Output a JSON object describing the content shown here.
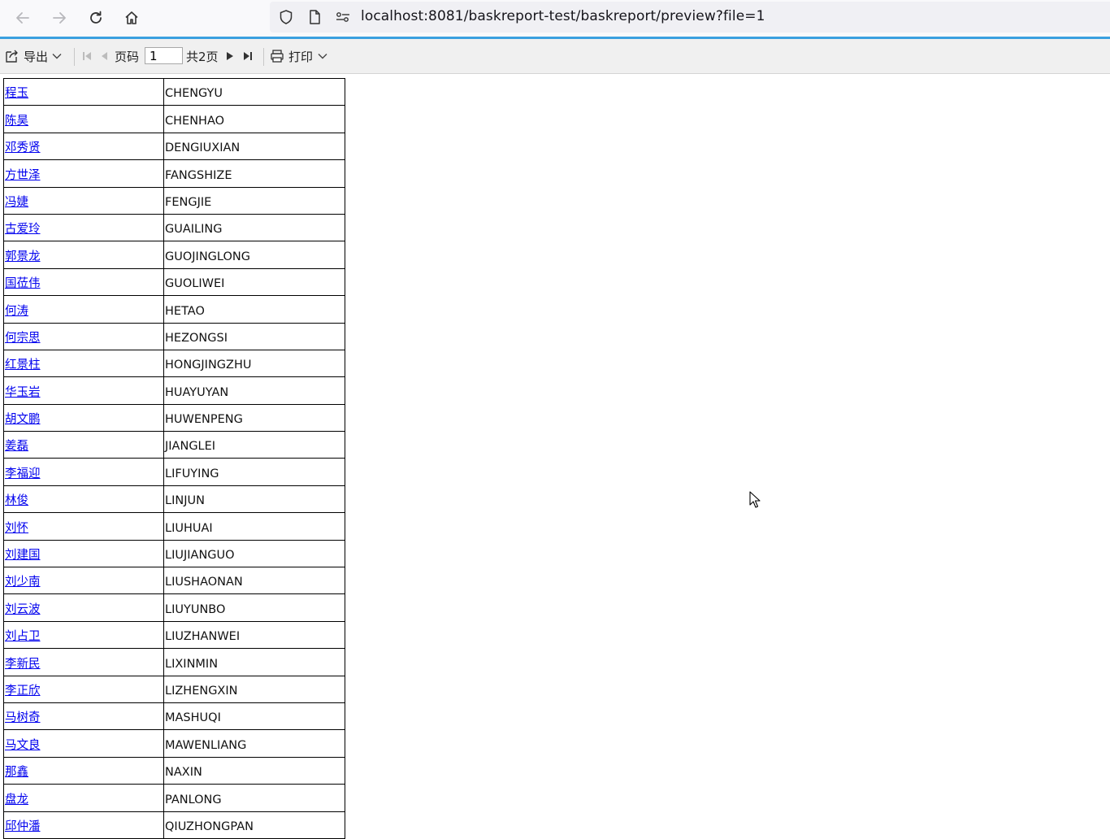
{
  "browser": {
    "url": "localhost:8081/baskreport-test/baskreport/preview?file=1",
    "icons": [
      "back-arrow-icon",
      "forward-arrow-icon",
      "reload-icon",
      "home-icon",
      "shield-icon",
      "page-icon",
      "permissions-icon"
    ]
  },
  "toolbar": {
    "export_label": "导出",
    "page_label": "页码",
    "page_value": "1",
    "total_pages": "共2页",
    "print_label": "打印"
  },
  "rows": [
    {
      "name": "程玉",
      "pinyin": "CHENGYU"
    },
    {
      "name": "陈昊",
      "pinyin": "CHENHAO"
    },
    {
      "name": "邓秀贤",
      "pinyin": "DENGIUXIAN"
    },
    {
      "name": "方世泽",
      "pinyin": "FANGSHIZE"
    },
    {
      "name": "冯婕",
      "pinyin": "FENGJIE"
    },
    {
      "name": "古爱玲",
      "pinyin": "GUAILING"
    },
    {
      "name": "郭景龙",
      "pinyin": "GUOJINGLONG"
    },
    {
      "name": "国莅伟",
      "pinyin": "GUOLIWEI"
    },
    {
      "name": "何涛",
      "pinyin": "HETAO"
    },
    {
      "name": "何宗思",
      "pinyin": "HEZONGSI"
    },
    {
      "name": "红景柱",
      "pinyin": "HONGJINGZHU"
    },
    {
      "name": "华玉岩",
      "pinyin": "HUAYUYAN"
    },
    {
      "name": "胡文鹏",
      "pinyin": "HUWENPENG"
    },
    {
      "name": "姜磊",
      "pinyin": "JIANGLEI"
    },
    {
      "name": "李福迎",
      "pinyin": "LIFUYING"
    },
    {
      "name": "林俊",
      "pinyin": "LINJUN"
    },
    {
      "name": "刘怀",
      "pinyin": "LIUHUAI"
    },
    {
      "name": "刘建国",
      "pinyin": "LIUJIANGUO"
    },
    {
      "name": "刘少南",
      "pinyin": "LIUSHAONAN"
    },
    {
      "name": "刘云波",
      "pinyin": "LIUYUNBO"
    },
    {
      "name": "刘占卫",
      "pinyin": "LIUZHANWEI"
    },
    {
      "name": "李新民",
      "pinyin": "LIXINMIN"
    },
    {
      "name": "李正欣",
      "pinyin": "LIZHENGXIN"
    },
    {
      "name": "马树奇",
      "pinyin": "MASHUQI"
    },
    {
      "name": "马文良",
      "pinyin": "MAWENLIANG"
    },
    {
      "name": "那鑫",
      "pinyin": "NAXIN"
    },
    {
      "name": "盘龙",
      "pinyin": "PANLONG"
    },
    {
      "name": "邱仲潘",
      "pinyin": "QIUZHONGPAN"
    }
  ]
}
